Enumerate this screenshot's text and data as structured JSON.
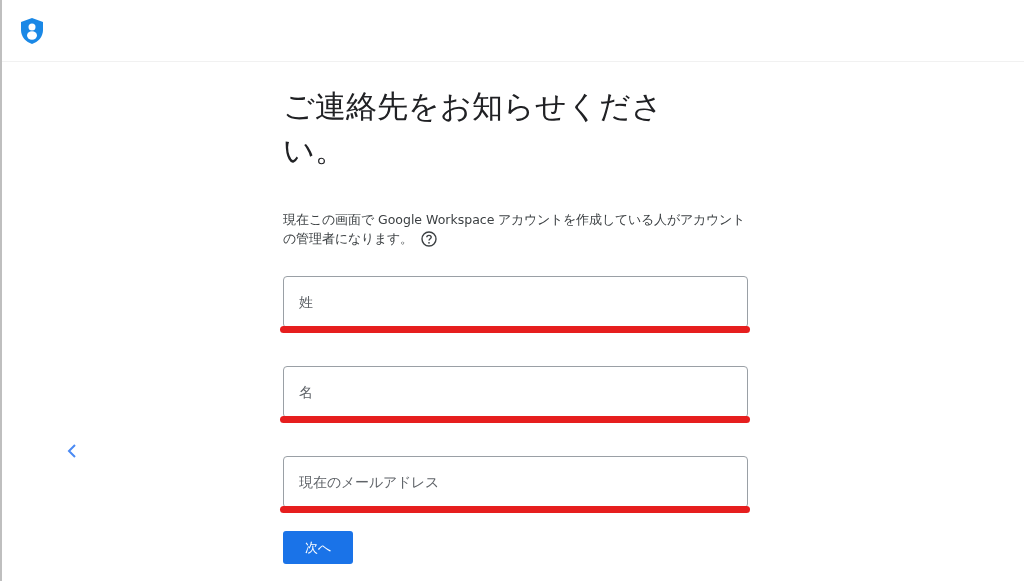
{
  "title": "ご連絡先をお知らせください。",
  "description_lines": [
    "現在この画面で Google Workspace アカウントを作成している人がアカウント",
    "の管理者になります。"
  ],
  "fields": [
    {
      "placeholder": "姓",
      "highlighted": true
    },
    {
      "placeholder": "名",
      "highlighted": true
    },
    {
      "placeholder": "現在のメールアドレス",
      "highlighted": true
    }
  ],
  "next_button": "次へ"
}
